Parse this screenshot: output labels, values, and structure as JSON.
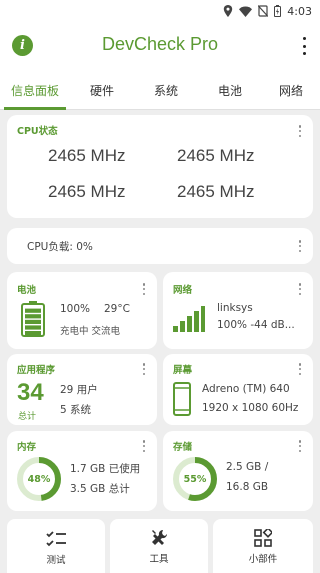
{
  "status_bar": {
    "time": "4:03"
  },
  "app": {
    "title": "DevCheck Pro"
  },
  "tabs": [
    {
      "label": "信息面板"
    },
    {
      "label": "硬件"
    },
    {
      "label": "系统"
    },
    {
      "label": "电池"
    },
    {
      "label": "网络"
    }
  ],
  "cpu": {
    "title": "CPU状态",
    "freqs": [
      "2465 MHz",
      "2465 MHz",
      "2465 MHz",
      "2465 MHz"
    ]
  },
  "cpu_load": {
    "text": "CPU负载: 0%"
  },
  "battery": {
    "title": "电池",
    "percent": "100%",
    "temp": "29°C",
    "status": "充电中 交流电",
    "level": 1.0
  },
  "network": {
    "title": "网络",
    "ssid": "linksys",
    "signal": "100%  -44 dB..."
  },
  "apps": {
    "title": "应用程序",
    "total": "34",
    "total_label": "总计",
    "user": "29 用户",
    "system": "5 系统"
  },
  "screen": {
    "title": "屏幕",
    "gpu": "Adreno (TM) 640",
    "resolution": "1920 x 1080  60Hz"
  },
  "memory": {
    "title": "内存",
    "percent_label": "48%",
    "percent": 48,
    "used": "1.7 GB 已使用",
    "total": "3.5 GB 总计"
  },
  "storage": {
    "title": "存储",
    "percent_label": "55%",
    "percent": 55,
    "used": "2.5 GB /",
    "total": "16.8 GB"
  },
  "bottom_nav": [
    {
      "label": "测试",
      "icon": "checklist-icon"
    },
    {
      "label": "工具",
      "icon": "tools-icon"
    },
    {
      "label": "小部件",
      "icon": "widgets-icon"
    }
  ],
  "colors": {
    "accent": "#5b9a32",
    "background": "#eeeeee"
  }
}
